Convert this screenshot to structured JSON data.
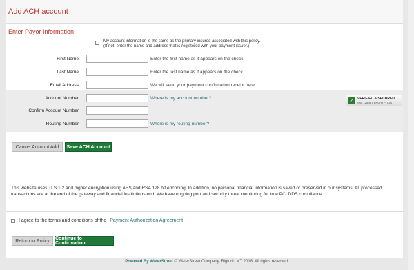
{
  "header": {
    "title": "Add ACH account"
  },
  "payor": {
    "section_title": "Enter Payor Information",
    "same_as_insured_line1": "My account information is the same as the primary insured associated with this policy.",
    "same_as_insured_line2": "(If not, enter the name and address that is registered with your payment issuer.)",
    "first_name": {
      "label": "First Name",
      "value": "",
      "hint": "Enter the first name as it appears on the check"
    },
    "last_name": {
      "label": "Last Name",
      "value": "",
      "hint": "Enter the last name as it appears on the check"
    },
    "email": {
      "label": "Email Address",
      "value": "",
      "hint": "We will send your payment confirmation receipt here"
    }
  },
  "account": {
    "account_number": {
      "label": "Account Number",
      "value": "",
      "link": "Where is my account number?"
    },
    "confirm_account": {
      "label": "Confirm Account Number",
      "value": ""
    },
    "routing_number": {
      "label": "Routing Number",
      "value": "",
      "link": "Where is my routing number?"
    }
  },
  "badge": {
    "line1": "VERIFIED & SECURED",
    "line2": "SSL 128-BIT ENCRYPTION",
    "icon": "shield-check-icon",
    "color": "#2e7d32"
  },
  "buttons": {
    "cancel": "Cancel Account Add",
    "save": "Save ACH Account",
    "return": "Return to Policy",
    "continue": "Continue to Confirmation"
  },
  "notice": "This website uses TLS 1.2 and higher encryption using AES and RSA 128 bit encoding. In addition, no personal financial information is saved or preserved in our systems. All processed transactions are at the end of the gateway and financial institutions end. We have ongoing port and security threat monitoring for true PCI DDS compliance.",
  "agree": {
    "text": "I agree to the terms and conditions of the",
    "link": "Payment Authorization Agreement"
  },
  "footer": {
    "powered": "Powered By WaterStreet",
    "copyright": "© WaterStreet Company, Bigfork, MT 2018. All rights reserved."
  },
  "colors": {
    "accent_red": "#b8332a",
    "green": "#1f7a3a",
    "link_teal": "#2f6f73"
  }
}
